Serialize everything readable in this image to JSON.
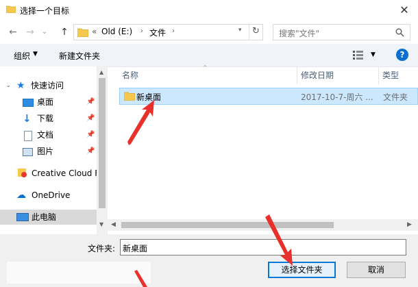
{
  "window": {
    "title": "选择一个目标",
    "close_glyph": "✕"
  },
  "nav": {
    "back_glyph": "←",
    "forward_glyph": "→",
    "dropdown_glyph": "⌄",
    "up_glyph": "↑",
    "breadcrumb_chevron": "«",
    "path": [
      {
        "label": "Old (E:)"
      },
      {
        "label": "文件"
      }
    ],
    "search_placeholder": "搜索\"文件\""
  },
  "toolbar": {
    "organize_label": "组织",
    "new_folder_label": "新建文件夹"
  },
  "sidebar": {
    "quick_access_label": "快速访问",
    "items": [
      {
        "label": "桌面",
        "icon": "desktop-icon"
      },
      {
        "label": "下载",
        "icon": "download-icon"
      },
      {
        "label": "文档",
        "icon": "document-icon"
      },
      {
        "label": "图片",
        "icon": "picture-icon"
      }
    ],
    "creative_cloud_label": "Creative Cloud F",
    "onedrive_label": "OneDrive",
    "this_pc_label": "此电脑"
  },
  "list": {
    "columns": {
      "name": "名称",
      "modified": "修改日期",
      "type": "类型"
    },
    "rows": [
      {
        "name": "新桌面",
        "modified": "2017-10-7-周六 ...",
        "type": "文件夹"
      }
    ]
  },
  "footer": {
    "folder_label": "文件夹:",
    "folder_value": "新桌面",
    "select_button": "选择文件夹",
    "cancel_button": "取消"
  },
  "colors": {
    "accent": "#0078d7",
    "selection": "#cce8ff",
    "arrow": "#e8312a",
    "folder": "#f6c94e"
  }
}
